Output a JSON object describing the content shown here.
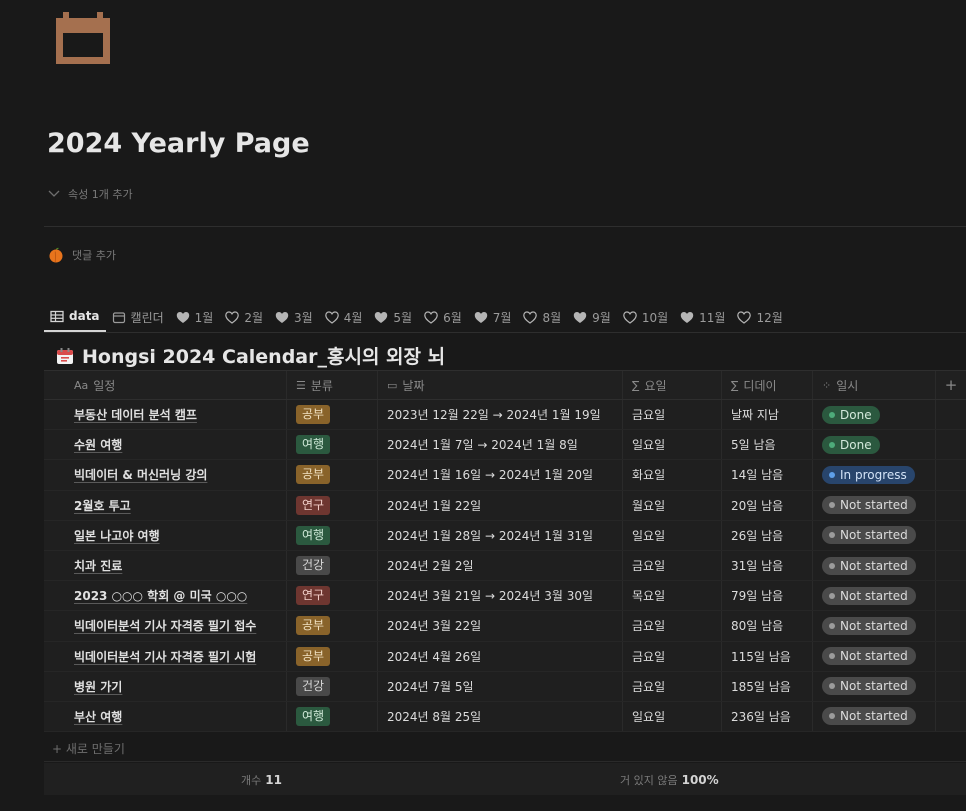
{
  "page": {
    "icon": "calendar-icon",
    "title": "2024 Yearly Page",
    "add_property": "속성 1개 추가",
    "add_comment": "댓글 추가"
  },
  "tabs": [
    {
      "label": "data",
      "icon": "table-icon",
      "active": true
    },
    {
      "label": "캘린더",
      "icon": "calendar-small-icon"
    },
    {
      "label": "1월",
      "icon": "heart-filled-icon"
    },
    {
      "label": "2월",
      "icon": "heart-outline-icon"
    },
    {
      "label": "3월",
      "icon": "heart-filled-icon"
    },
    {
      "label": "4월",
      "icon": "heart-outline-icon"
    },
    {
      "label": "5월",
      "icon": "heart-filled-icon"
    },
    {
      "label": "6월",
      "icon": "heart-outline-icon"
    },
    {
      "label": "7월",
      "icon": "heart-filled-icon"
    },
    {
      "label": "8월",
      "icon": "heart-outline-icon"
    },
    {
      "label": "9월",
      "icon": "heart-filled-icon"
    },
    {
      "label": "10월",
      "icon": "heart-outline-icon"
    },
    {
      "label": "11월",
      "icon": "heart-filled-icon"
    },
    {
      "label": "12월",
      "icon": "heart-outline-icon"
    }
  ],
  "database": {
    "title": "Hongsi 2024 Calendar_홍시의 외장 뇌",
    "columns": [
      {
        "icon": "Aa",
        "label": "일정"
      },
      {
        "icon": "☰",
        "label": "분류"
      },
      {
        "icon": "▭",
        "label": "날짜"
      },
      {
        "icon": "∑",
        "label": "요일"
      },
      {
        "icon": "∑",
        "label": "디데이"
      },
      {
        "icon": "⁘",
        "label": "일시"
      },
      {
        "icon": "+",
        "label": ""
      }
    ],
    "rows": [
      {
        "title": "부동산 데이터 분석 캠프",
        "category": "공부",
        "date": "2023년 12월 22일 → 2024년 1월 19일",
        "weekday": "금요일",
        "dday": "날짜 지남",
        "status": "Done"
      },
      {
        "title": "수원 여행",
        "category": "여행",
        "date": "2024년 1월 7일 → 2024년 1월 8일",
        "weekday": "일요일",
        "dday": "5일 남음",
        "status": "Done"
      },
      {
        "title": "빅데이터 & 머신러닝 강의",
        "category": "공부",
        "date": "2024년 1월 16일 → 2024년 1월 20일",
        "weekday": "화요일",
        "dday": "14일 남음",
        "status": "In progress"
      },
      {
        "title": "2월호 투고",
        "category": "연구",
        "date": "2024년 1월 22일",
        "weekday": "월요일",
        "dday": "20일 남음",
        "status": "Not started"
      },
      {
        "title": "일본 나고야 여행",
        "category": "여행",
        "date": "2024년 1월 28일 → 2024년 1월 31일",
        "weekday": "일요일",
        "dday": "26일 남음",
        "status": "Not started"
      },
      {
        "title": "치과 진료",
        "category": "건강",
        "date": "2024년 2월 2일",
        "weekday": "금요일",
        "dday": "31일 남음",
        "status": "Not started"
      },
      {
        "title": "2023 ○○○ 학회 @ 미국 ○○○",
        "category": "연구",
        "date": "2024년 3월 21일 → 2024년 3월 30일",
        "weekday": "목요일",
        "dday": "79일 남음",
        "status": "Not started"
      },
      {
        "title": "빅데이터분석 기사 자격증 필기 접수",
        "category": "공부",
        "date": "2024년 3월 22일",
        "weekday": "금요일",
        "dday": "80일 남음",
        "status": "Not started"
      },
      {
        "title": "빅데이터분석 기사 자격증 필기 시험",
        "category": "공부",
        "date": "2024년 4월 26일",
        "weekday": "금요일",
        "dday": "115일 남음",
        "status": "Not started"
      },
      {
        "title": "병원 가기",
        "category": "건강",
        "date": "2024년 7월 5일",
        "weekday": "금요일",
        "dday": "185일 남음",
        "status": "Not started"
      },
      {
        "title": "부산 여행",
        "category": "여행",
        "date": "2024년 8월 25일",
        "weekday": "일요일",
        "dday": "236일 남음",
        "status": "Not started"
      }
    ],
    "new_row": "+ 새로 만들기",
    "footer": {
      "count_label": "개수",
      "count_value": "11",
      "pct_label": "거 있지 않음",
      "pct_value": "100%"
    }
  },
  "colors": {
    "background": "#191919",
    "icon_brown": "#a5704f",
    "category": {
      "공부": {
        "bg": "#89632a",
        "fg": "#f0e0c0"
      },
      "여행": {
        "bg": "#2b593f",
        "fg": "#cfe9d8"
      },
      "연구": {
        "bg": "#6e3630",
        "fg": "#f2cfc9"
      },
      "건강": {
        "bg": "#494949",
        "fg": "#d8d8d8"
      }
    },
    "status": {
      "Done": {
        "bg": "#2b593f",
        "fg": "#d4eadc",
        "dot": "#4dab7a"
      },
      "In progress": {
        "bg": "#28456c",
        "fg": "#d3e3f7",
        "dot": "#5e9fe8"
      },
      "Not started": {
        "bg": "#4a4a4a",
        "fg": "#dcdcdc",
        "dot": "#9b9b9b"
      }
    }
  }
}
